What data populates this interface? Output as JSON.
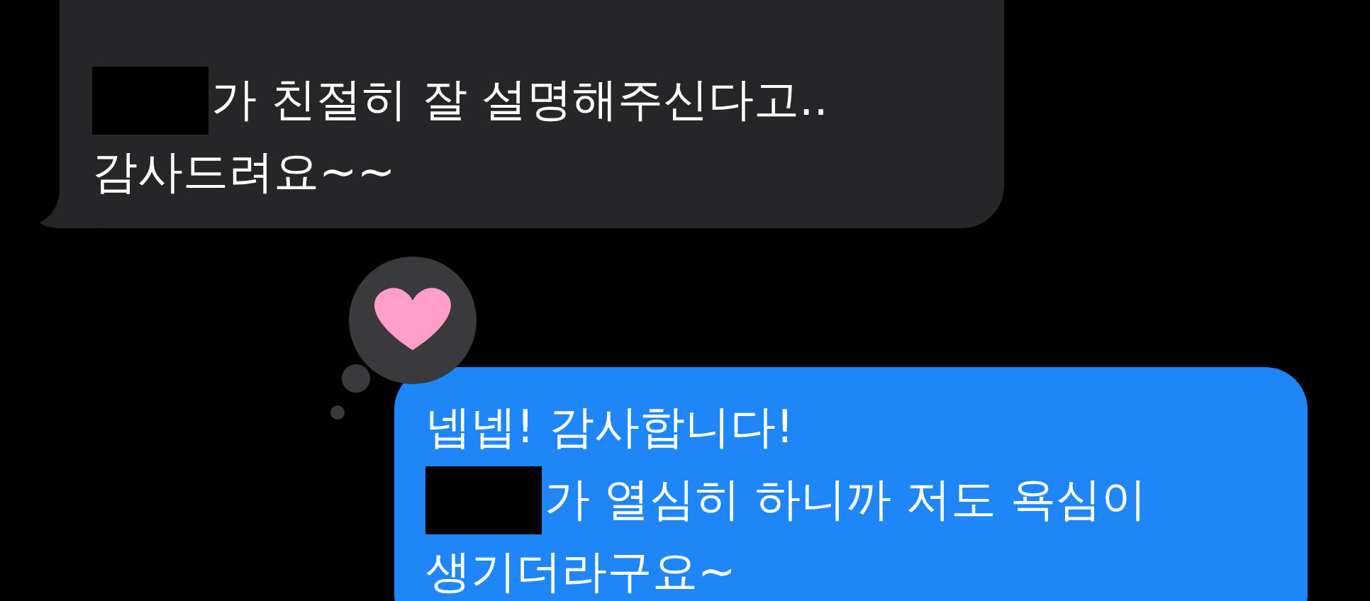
{
  "messages": [
    {
      "kind": "received",
      "lines": [
        {
          "redacted": true,
          "text": "가 친절히 잘 설명해주신다고.."
        },
        {
          "redacted": false,
          "text": "감사드려요~~"
        }
      ]
    },
    {
      "kind": "sent",
      "reaction": {
        "kind": "heart"
      },
      "lines": [
        {
          "redacted": false,
          "text": "넵넵! 감사합니다!"
        },
        {
          "redacted": true,
          "text": "가 열심히 하니까 저도 욕심이"
        },
        {
          "redacted": false,
          "text": "생기더라구요~"
        }
      ]
    }
  ]
}
